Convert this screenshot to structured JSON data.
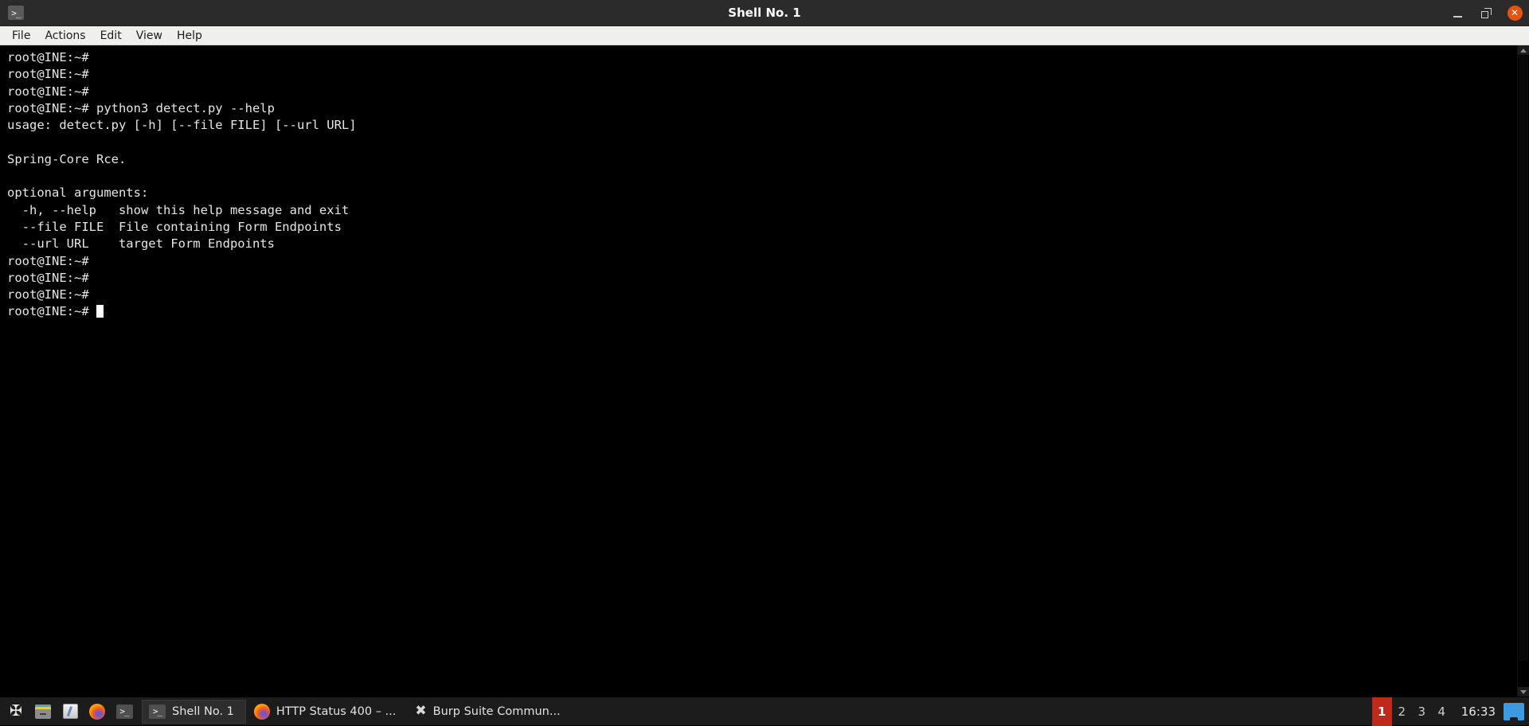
{
  "window": {
    "title": "Shell No. 1",
    "icon": "terminal-icon",
    "controls": {
      "minimize": "—",
      "maximize": "❐",
      "close": "✕"
    }
  },
  "menubar": {
    "items": [
      {
        "label": "File"
      },
      {
        "label": "Actions"
      },
      {
        "label": "Edit"
      },
      {
        "label": "View"
      },
      {
        "label": "Help"
      }
    ]
  },
  "terminal": {
    "prompt": "root@INE:~#",
    "lines": [
      "root@INE:~#",
      "root@INE:~#",
      "root@INE:~#",
      "root@INE:~# python3 detect.py --help",
      "usage: detect.py [-h] [--file FILE] [--url URL]",
      "",
      "Spring-Core Rce.",
      "",
      "optional arguments:",
      "  -h, --help   show this help message and exit",
      "  --file FILE  File containing Form Endpoints",
      "  --url URL    target Form Endpoints",
      "root@INE:~#",
      "root@INE:~#",
      "root@INE:~#"
    ],
    "cursor_line": "root@INE:~# ",
    "colors": {
      "background": "#000000",
      "foreground": "#e6e6e6",
      "cursor": "#ffffff"
    }
  },
  "taskbar": {
    "launchers": [
      {
        "name": "applications-tool-icon",
        "glyph": "✂"
      },
      {
        "name": "file-manager-icon",
        "glyph": ""
      },
      {
        "name": "text-editor-icon",
        "glyph": ""
      },
      {
        "name": "firefox-icon",
        "glyph": ""
      },
      {
        "name": "terminal-icon",
        "glyph": ">_"
      }
    ],
    "tasks": [
      {
        "icon": "terminal-icon",
        "label": "Shell No. 1",
        "active": true
      },
      {
        "icon": "firefox-icon",
        "label": "HTTP Status 400 – ...",
        "active": false
      },
      {
        "icon": "burp-suite-icon",
        "label": "Burp Suite Commun...",
        "active": false
      }
    ],
    "workspaces": [
      {
        "label": "1",
        "active": true
      },
      {
        "label": "2",
        "active": false
      },
      {
        "label": "3",
        "active": false
      },
      {
        "label": "4",
        "active": false
      }
    ],
    "clock": "16:33",
    "show_desktop": "show-desktop",
    "accent_color": "#c0281c"
  }
}
